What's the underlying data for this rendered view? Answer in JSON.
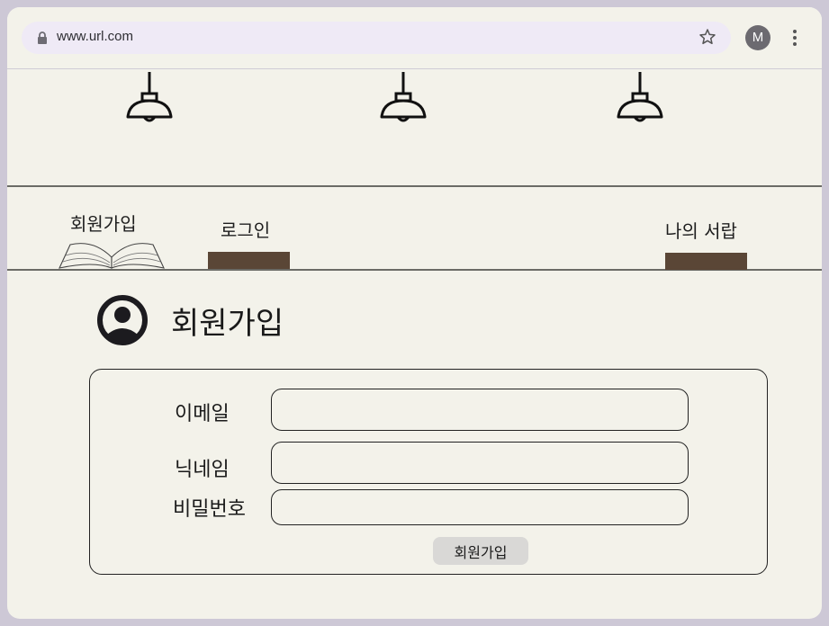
{
  "browser": {
    "url": "www.url.com",
    "profile_initial": "M",
    "icons": [
      "lock-icon",
      "star-icon",
      "kebab-menu-icon"
    ]
  },
  "nav": {
    "signup_label": "회원가입",
    "login_label": "로그인",
    "my_shelf_label": "나의 서랍"
  },
  "page": {
    "title": "회원가입"
  },
  "form": {
    "email_label": "이메일",
    "email_value": "",
    "nickname_label": "닉네임",
    "nickname_value": "",
    "password_label": "비밀번호",
    "password_value": "",
    "submit_label": "회원가입"
  },
  "colors": {
    "background": "#f3f2ea",
    "nav_bar": "#5a4636",
    "frame": "#cdc8d6",
    "button": "#d9d8d6"
  }
}
